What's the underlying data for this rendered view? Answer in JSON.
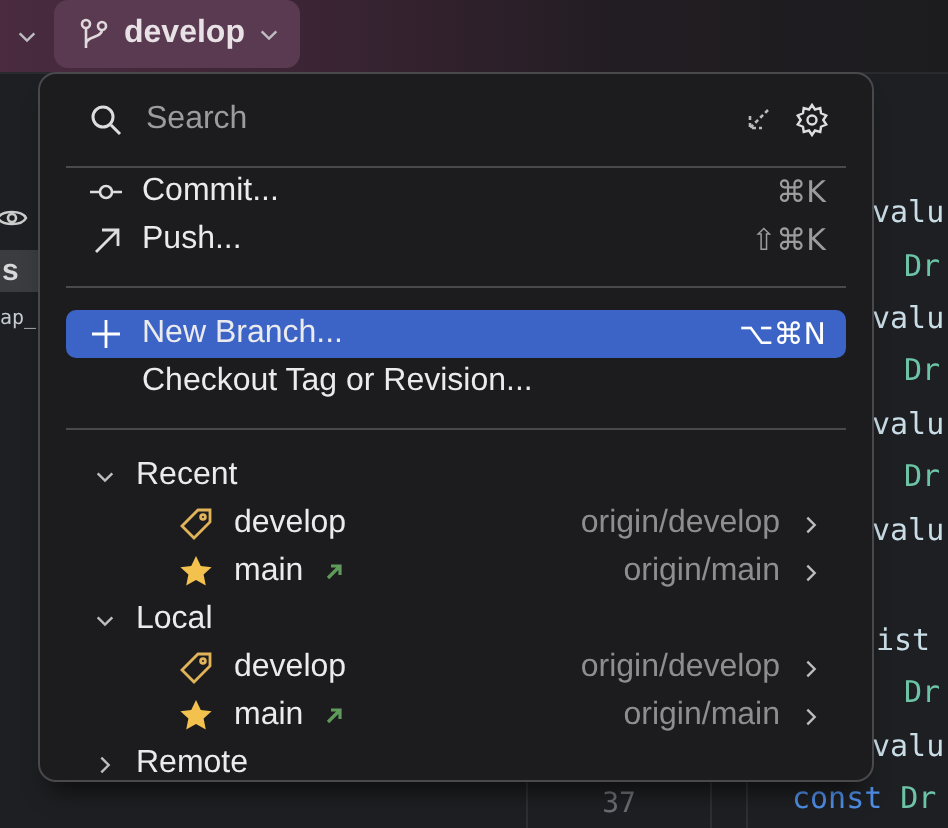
{
  "toolbar": {
    "branch_button": {
      "label": "develop"
    }
  },
  "side_panel": {
    "tab": "s",
    "text": "ap_"
  },
  "editor": {
    "line_number": "37",
    "code": [
      [
        {
          "tokens": [
            {
              "text": "valu",
              "kind": "property"
            }
          ]
        },
        {
          "tokens": [
            {
              "text": "Dr",
              "kind": "type"
            }
          ]
        },
        {
          "tokens": [
            {
              "text": "valu",
              "kind": "property"
            }
          ]
        },
        {
          "tokens": [
            {
              "text": "Dr",
              "kind": "type"
            }
          ]
        },
        {
          "tokens": [
            {
              "text": "valu",
              "kind": "property"
            }
          ]
        },
        {
          "tokens": [
            {
              "text": "Dr",
              "kind": "type"
            }
          ]
        },
        {
          "tokens": [
            {
              "text": "valu",
              "kind": "property"
            }
          ]
        }
      ],
      [
        {
          "tokens": [
            {
              "text": "ist",
              "kind": "property"
            }
          ]
        },
        {
          "tokens": [
            {
              "text": "Dr",
              "kind": "type"
            }
          ]
        },
        {
          "tokens": [
            {
              "text": "valu",
              "kind": "property"
            }
          ]
        },
        {
          "tokens": [
            {
              "text": "const",
              "kind": "keyword"
            },
            {
              "text": "Dr",
              "kind": "type"
            }
          ]
        }
      ]
    ]
  },
  "popup": {
    "search": {
      "placeholder": "Search"
    },
    "action_groups": [
      [
        {
          "kind": "commit",
          "label": "Commit...",
          "shortcut": "⌘K",
          "selected": false
        },
        {
          "kind": "push",
          "label": "Push...",
          "shortcut": "⇧⌘K",
          "selected": false
        }
      ],
      [
        {
          "kind": "add",
          "label": "New Branch...",
          "shortcut": "⌥⌘N",
          "selected": true
        },
        {
          "kind": "plain",
          "label": "Checkout Tag or Revision...",
          "selected": false
        }
      ]
    ],
    "groups": [
      {
        "label": "Recent",
        "expanded": true,
        "branches": [
          {
            "kind": "tag",
            "name": "develop",
            "remote": "origin/develop",
            "outgoing": false
          },
          {
            "kind": "star",
            "name": "main",
            "remote": "origin/main",
            "outgoing": true
          }
        ]
      },
      {
        "label": "Local",
        "expanded": true,
        "branches": [
          {
            "kind": "tag",
            "name": "develop",
            "remote": "origin/develop",
            "outgoing": false
          },
          {
            "kind": "star",
            "name": "main",
            "remote": "origin/main",
            "outgoing": true
          }
        ]
      },
      {
        "label": "Remote",
        "expanded": false
      }
    ]
  }
}
